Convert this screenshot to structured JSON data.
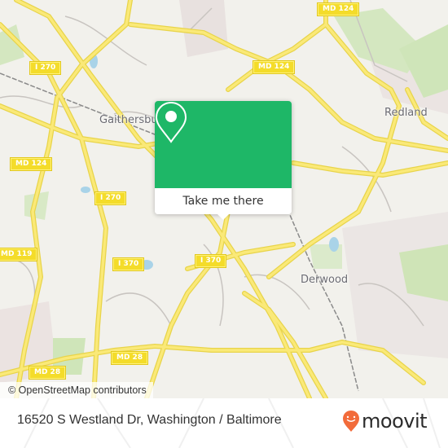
{
  "map": {
    "attribution": "© OpenStreetMap contributors",
    "road_shields": [
      {
        "label": "MD 124"
      },
      {
        "label": "I 270"
      },
      {
        "label": "MD 124"
      },
      {
        "label": "MD 124"
      },
      {
        "label": "I 270"
      },
      {
        "label": "MD 119"
      },
      {
        "label": "I 370"
      },
      {
        "label": "I 370"
      },
      {
        "label": "MD 28"
      },
      {
        "label": "MD 28"
      }
    ],
    "places": [
      {
        "label": "Gaithersburg"
      },
      {
        "label": "Redland"
      },
      {
        "label": "Derwood"
      }
    ]
  },
  "popup": {
    "icon": "location-pin-icon",
    "button_label": "Take me there",
    "accent_color": "#1eb767"
  },
  "footer": {
    "address": "16520 S Westland Dr, Washington / Baltimore",
    "logo_text": "moovit",
    "logo_color": "#f26b3a"
  }
}
